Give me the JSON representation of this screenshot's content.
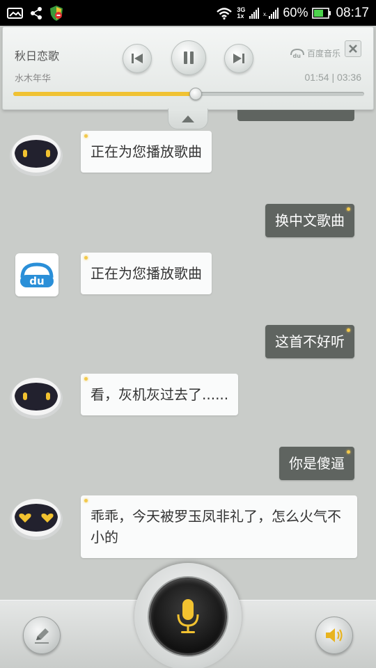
{
  "status_bar": {
    "network_top": "3G",
    "network_bottom": "1x",
    "battery": "60%",
    "time": "08:17",
    "icons": [
      "image-icon",
      "share-icon",
      "shield-icon",
      "wifi-icon",
      "signal-icon",
      "battery-icon"
    ]
  },
  "player": {
    "song": "秋日恋歌",
    "artist": "水木年华",
    "source": "百度音乐",
    "source_logo_text": "du",
    "time": "01:54 | 03:36",
    "progress": 0.52,
    "state": "playing",
    "accent_color": "#f0c233"
  },
  "chat": {
    "messages": [
      {
        "from": "bot",
        "avatar": "robot",
        "text": "正在为您播放歌曲"
      },
      {
        "from": "user",
        "text": "换中文歌曲"
      },
      {
        "from": "bot",
        "avatar": "baidu-music",
        "avatar_text": "du",
        "text": "正在为您播放歌曲"
      },
      {
        "from": "user",
        "text": "这首不好听"
      },
      {
        "from": "bot",
        "avatar": "robot",
        "text": "看，灰机灰过去了......"
      },
      {
        "from": "user",
        "text": "你是傻逼"
      },
      {
        "from": "bot",
        "avatar": "robot-heart-eyes",
        "text": "乖乖，今天被罗玉凤非礼了，怎么火气不小的"
      }
    ]
  },
  "bottom_bar": {
    "icons": [
      "pencil-icon",
      "microphone-icon",
      "speaker-icon"
    ],
    "mic_color": "#f2c230"
  }
}
